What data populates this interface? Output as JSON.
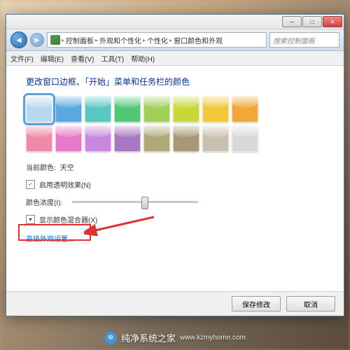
{
  "nav": {
    "breadcrumb": [
      "控制面板",
      "外观和个性化",
      "个性化",
      "窗口颜色和外观"
    ],
    "search_placeholder": "搜索控制面板"
  },
  "menu": [
    "文件(F)",
    "编辑(E)",
    "查看(V)",
    "工具(T)",
    "帮助(H)"
  ],
  "heading": "更改窗口边框、「开始」菜单和任务栏的颜色",
  "swatches": [
    {
      "color": "#b8d8f0",
      "selected": true
    },
    {
      "color": "#5aa8e0"
    },
    {
      "color": "#58c8c0"
    },
    {
      "color": "#50c878"
    },
    {
      "color": "#a0d058"
    },
    {
      "color": "#c8d838"
    },
    {
      "color": "#f0c838"
    },
    {
      "color": "#f0a838"
    },
    {
      "color": "#f088a8"
    },
    {
      "color": "#e878c8"
    },
    {
      "color": "#c888e0"
    },
    {
      "color": "#a878c0"
    },
    {
      "color": "#b0a878"
    },
    {
      "color": "#a89878"
    },
    {
      "color": "#c8c0b0"
    },
    {
      "color": "#d8d8d8"
    }
  ],
  "current_color_label": "当前颜色:",
  "current_color_value": "天空",
  "transparency_label": "启用透明效果(N)",
  "transparency_checked": true,
  "intensity_label": "颜色浓度(I):",
  "mixer_label": "显示颜色混合器(X)",
  "advanced_link": "高级外观设置...",
  "buttons": {
    "save": "保存修改",
    "cancel": "取消"
  },
  "watermark": {
    "brand": "纯净系统之家",
    "url": "www.kzmyhome.com"
  }
}
